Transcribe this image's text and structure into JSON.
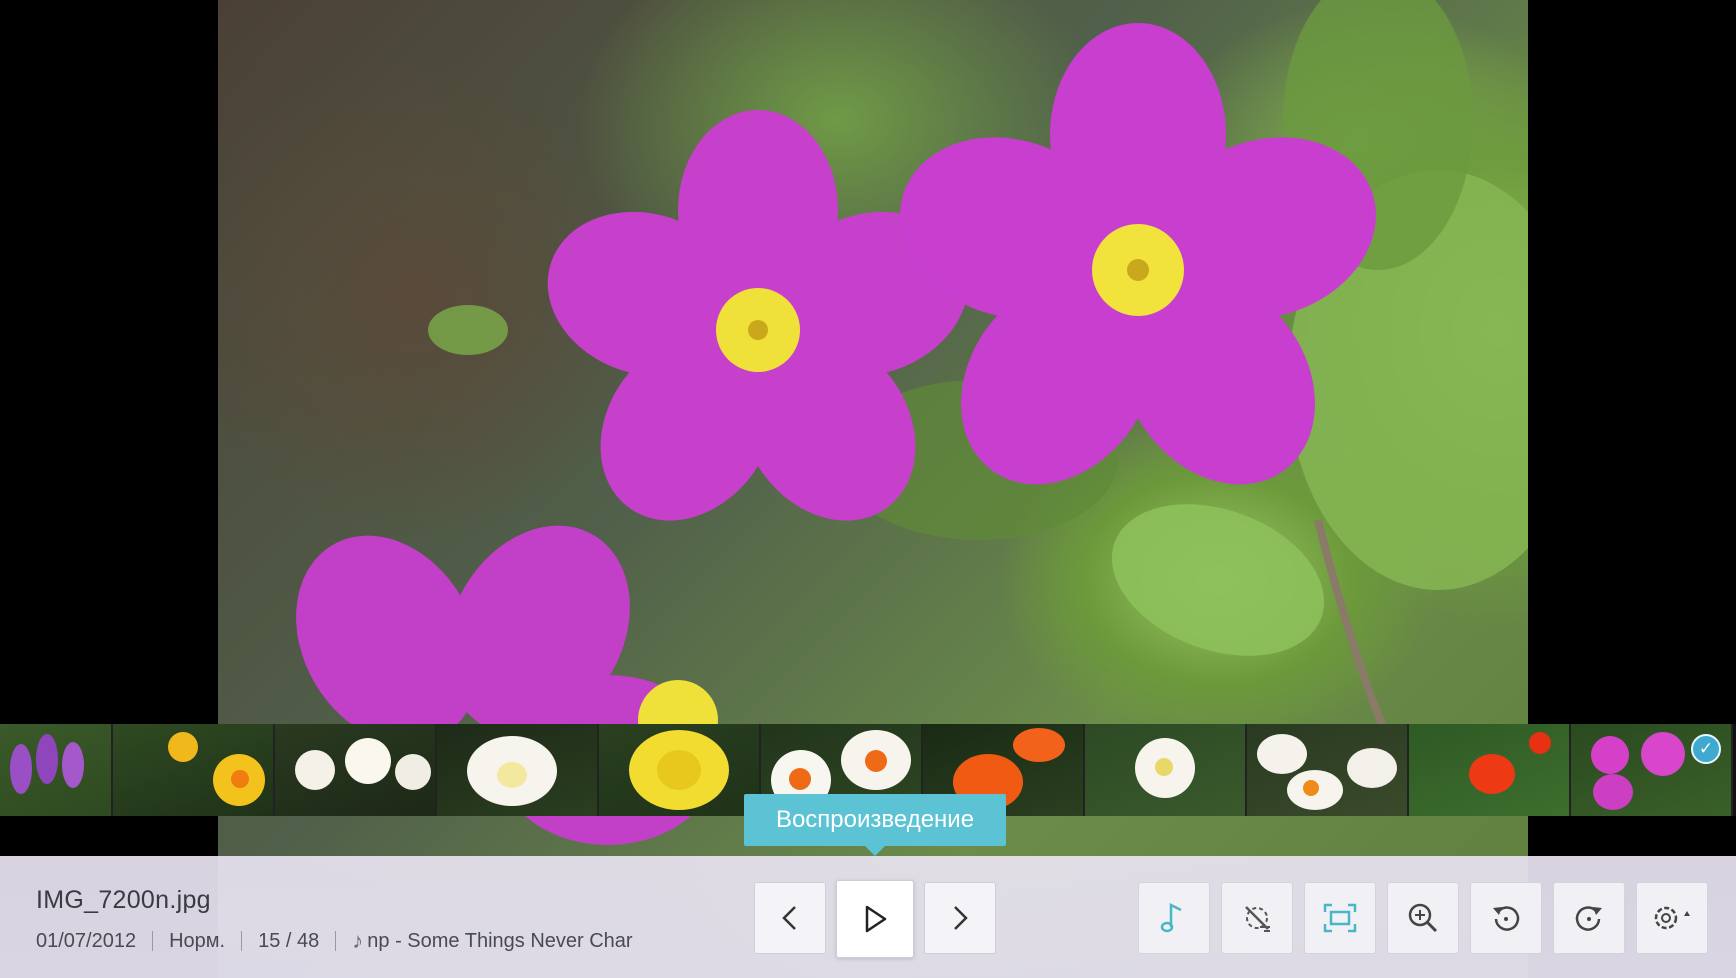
{
  "viewer": {
    "file_name": "IMG_7200n.jpg",
    "date": "01/07/2012",
    "speed": "Норм.",
    "position": "15 / 48",
    "music_track": "np - Some Things Never Char",
    "tooltip": "Воспроизведение"
  },
  "thumbnails": [
    {
      "label": "purple-crocus"
    },
    {
      "label": "yellow-daffodils"
    },
    {
      "label": "white-narcissus"
    },
    {
      "label": "white-narcissus-closeup"
    },
    {
      "label": "double-yellow-daffodil"
    },
    {
      "label": "white-orange-narcissus"
    },
    {
      "label": "orange-lilies"
    },
    {
      "label": "white-narcissus-grass"
    },
    {
      "label": "white-orange-narcissus-cluster"
    },
    {
      "label": "red-tulips"
    },
    {
      "label": "pink-primrose",
      "selected": true
    }
  ],
  "controls": {
    "prev": "previous",
    "play": "play",
    "next": "next",
    "buttons": [
      "music",
      "effect-off",
      "fit-screen",
      "zoom",
      "rotate-left",
      "rotate-right",
      "settings"
    ]
  },
  "colors": {
    "accent": "#5bc3d3",
    "bar_background": "#e4e0ee",
    "primrose_petal": "#c23fc8",
    "primrose_center": "#f2e23c"
  }
}
